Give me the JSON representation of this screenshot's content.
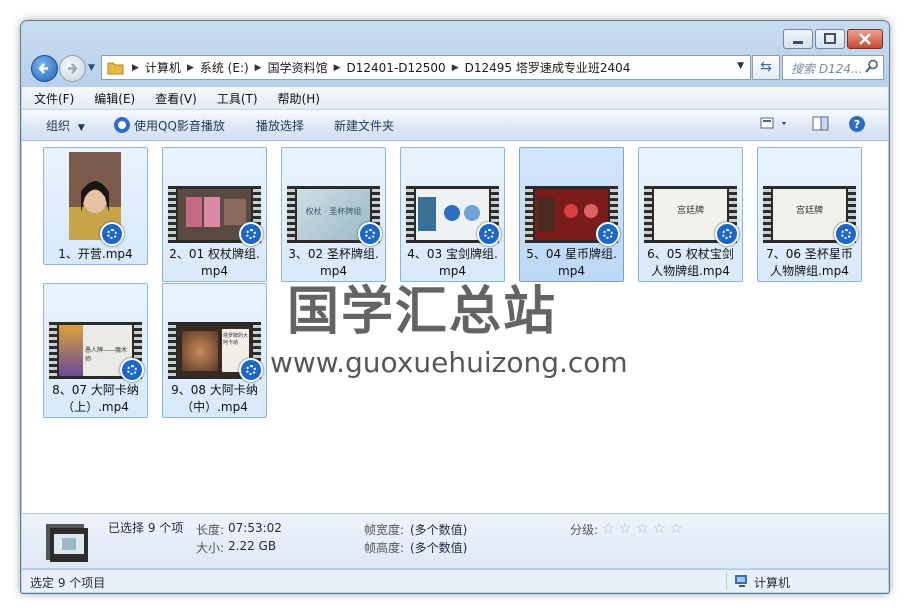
{
  "nav": {
    "breadcrumbs": [
      "计算机",
      "系统 (E:)",
      "国学资料馆",
      "D12401-D12500",
      "D12495 塔罗速成专业班2404"
    ],
    "search_placeholder": "搜索 D124..."
  },
  "menu": [
    "文件(F)",
    "编辑(E)",
    "查看(V)",
    "工具(T)",
    "帮助(H)"
  ],
  "toolbar": {
    "organize": "组织",
    "play_qq": "使用QQ影音播放",
    "play_selection": "播放选择",
    "new_folder": "新建文件夹"
  },
  "files": [
    {
      "line1": "1、开营.mp4",
      "line2": ""
    },
    {
      "line1": "2、01 权杖牌组.",
      "line2": "mp4"
    },
    {
      "line1": "3、02 圣杯牌组.",
      "line2": "mp4"
    },
    {
      "line1": "4、03 宝剑牌组.",
      "line2": "mp4"
    },
    {
      "line1": "5、04 星币牌组.",
      "line2": "mp4"
    },
    {
      "line1": "6、05 权杖宝剑",
      "line2": "人物牌组.mp4"
    },
    {
      "line1": "7、06 圣杯星币",
      "line2": "人物牌组.mp4"
    },
    {
      "line1": "8、07 大阿卡纳",
      "line2": "（上）.mp4"
    },
    {
      "line1": "9、08 大阿卡纳",
      "line2": "（中）.mp4"
    }
  ],
  "thumb_text": {
    "t3": "权杖 · 圣杯牌组",
    "t6": "宫廷牌",
    "t7": "宫廷牌",
    "t8": "愚人牌——魔术师",
    "t9": "塔罗牌的大阿卡纳"
  },
  "watermark": {
    "cn": "国学汇总站",
    "en": "www.guoxuehuizong.com"
  },
  "details": {
    "selected": "已选择 9 个项",
    "length_label": "长度:",
    "length_value": "07:53:02",
    "size_label": "大小:",
    "size_value": "2.22 GB",
    "width_label": "帧宽度:",
    "width_value": "(多个数值)",
    "height_label": "帧高度:",
    "height_value": "(多个数值)",
    "rating_label": "分级:",
    "rating_stars": 0
  },
  "status": {
    "left": "选定 9 个项目",
    "right": "计算机"
  }
}
